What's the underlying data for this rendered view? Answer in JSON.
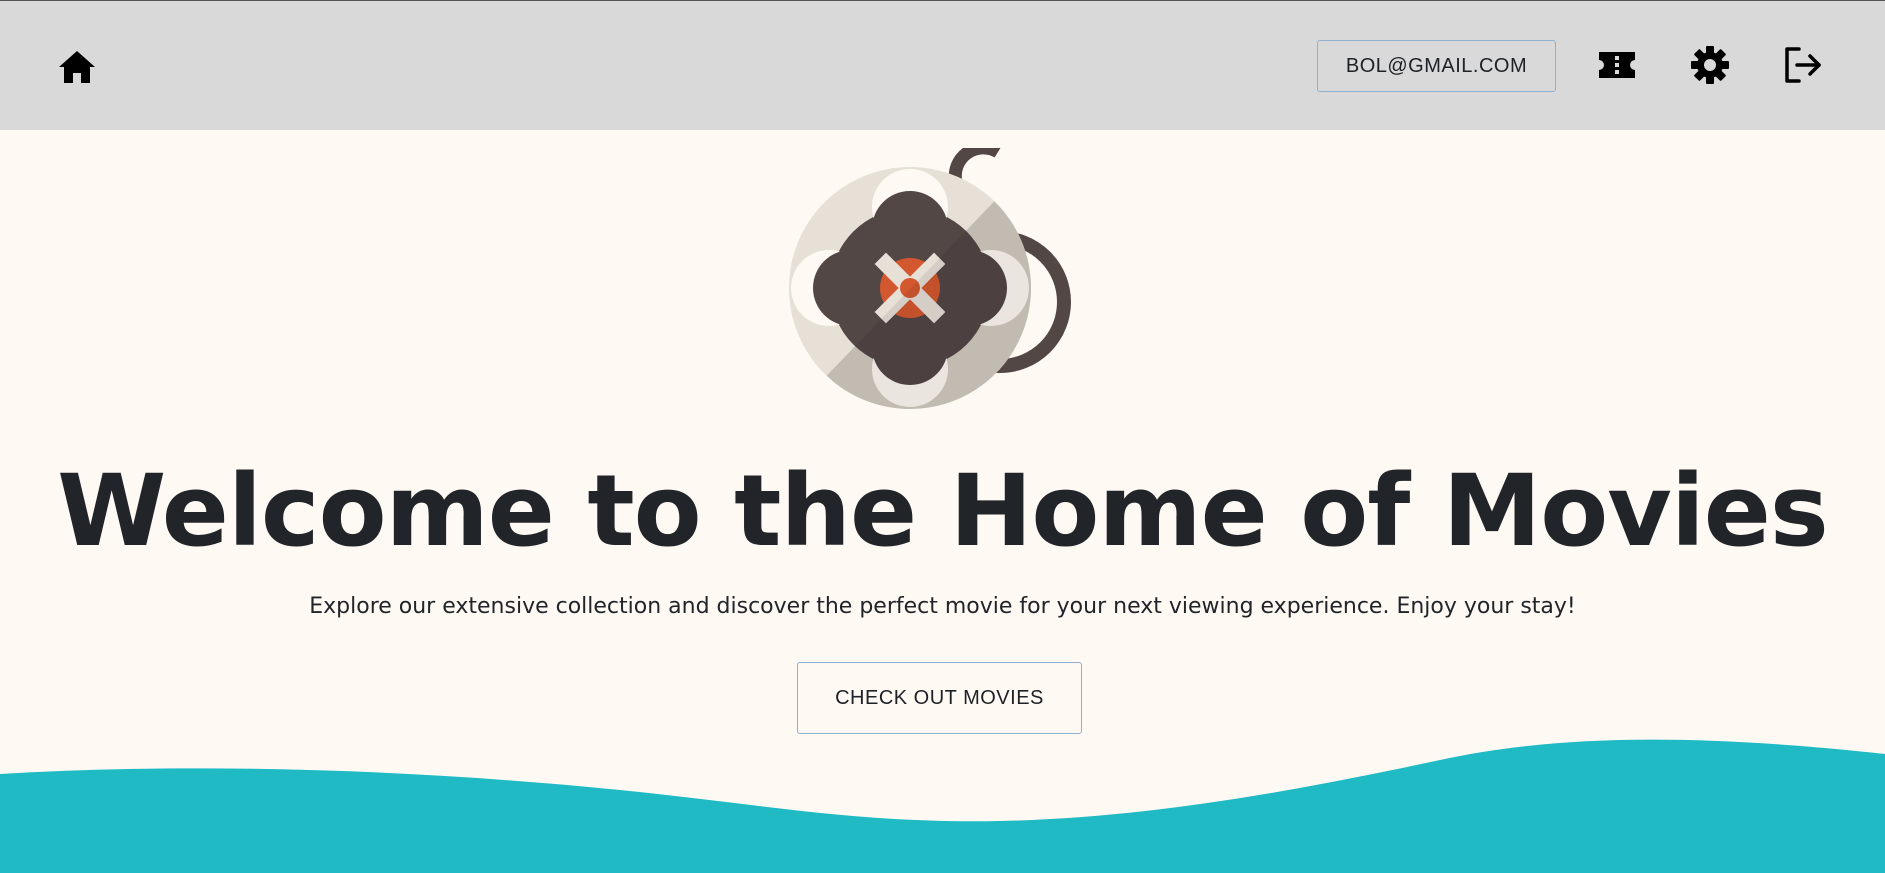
{
  "header": {
    "home_icon": "home-icon",
    "user_email": "BOL@GMAIL.COM",
    "ticket_icon": "ticket-icon",
    "settings_icon": "gear-icon",
    "logout_icon": "logout-icon"
  },
  "hero": {
    "logo_icon": "film-reel-icon",
    "title": "Welcome to the Home of Movies",
    "subtitle": "Explore our extensive collection and discover the perfect movie for your next viewing experience. Enjoy your stay!",
    "cta_label": "CHECK OUT MOVIES"
  },
  "colors": {
    "header_bg": "#d9d9d9",
    "page_bg": "#fff9f4",
    "wave": "#1fbac4",
    "text": "#212529",
    "button_border": "#8fb0cf",
    "reel_dark": "#534746",
    "reel_light": "#e6e0d7",
    "reel_accent": "#d4582f"
  }
}
